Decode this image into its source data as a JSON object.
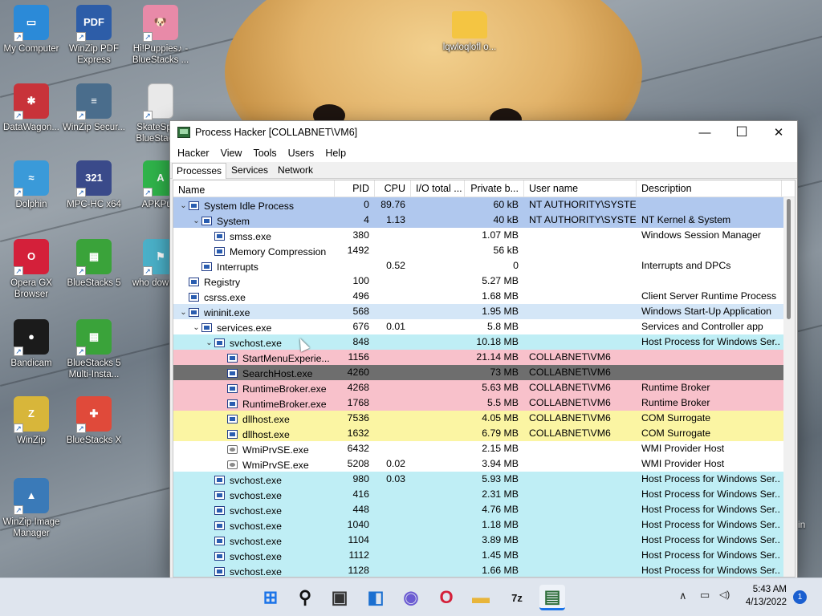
{
  "desktop": {
    "icons": [
      {
        "label": "My Computer",
        "color": "#2b8ad8",
        "glyph": "▭",
        "icon": "monitor-icon"
      },
      {
        "label": "WinZip PDF Express",
        "color": "#2d5da8",
        "glyph": "PDF",
        "icon": "pdf-icon"
      },
      {
        "label": "Hi!Puppies♪ - BlueStacks ...",
        "color": "#e88aa8",
        "glyph": "🐶",
        "icon": "puppy-game-icon"
      },
      {
        "label": "DataWagon...",
        "color": "#c8333a",
        "glyph": "✱",
        "icon": "datawagon-icon"
      },
      {
        "label": "WinZip Secur...",
        "color": "#4a6d8c",
        "glyph": "≡",
        "icon": "server-icon"
      },
      {
        "label": "SkateSpa... BlueStack...",
        "color": "#e9e9e9",
        "glyph": "",
        "icon": "document-icon"
      },
      {
        "label": "Dolphin",
        "color": "#3a9ad9",
        "glyph": "≈",
        "icon": "dolphin-icon"
      },
      {
        "label": "MPC-HC x64",
        "color": "#3a4a8a",
        "glyph": "321",
        "icon": "mpc-hc-icon"
      },
      {
        "label": "APKPu...",
        "color": "#2fb34a",
        "glyph": "A",
        "icon": "apkpure-icon"
      },
      {
        "label": "Opera GX Browser",
        "color": "#d4203a",
        "glyph": "O",
        "icon": "opera-gx-icon"
      },
      {
        "label": "BlueStacks 5",
        "color": "#3aa33a",
        "glyph": "▦",
        "icon": "bluestacks-icon"
      },
      {
        "label": "who downlo...",
        "color": "#4ab0c8",
        "glyph": "⚑",
        "icon": "walker-icon"
      },
      {
        "label": "Bandicam",
        "color": "#1b1b1b",
        "glyph": "●",
        "icon": "bandicam-icon"
      },
      {
        "label": "BlueStacks 5 Multi-Insta...",
        "color": "#3aa33a",
        "glyph": "▦",
        "icon": "bluestacks-multi-icon"
      },
      {
        "label": "WinZip",
        "color": "#d8b63a",
        "glyph": "Z",
        "icon": "winzip-icon"
      },
      {
        "label": "BlueStacks X",
        "color": "#e04a3a",
        "glyph": "✚",
        "icon": "bluestacks-x-icon"
      },
      {
        "label": "WinZip Image Manager",
        "color": "#3a7ab8",
        "glyph": "▲",
        "icon": "image-manager-icon"
      },
      {
        "label": "lqwloqlofl o...",
        "color": "#f4c542",
        "glyph": "",
        "icon": "folder-icon"
      }
    ],
    "edge_text": "in"
  },
  "window": {
    "title": "Process Hacker [COLLABNET\\VM6]",
    "controls": {
      "minimize": "—",
      "maximize": "☐",
      "close": "✕"
    },
    "menu": [
      "Hacker",
      "View",
      "Tools",
      "Users",
      "Help"
    ],
    "tabs": [
      "Processes",
      "Services",
      "Network"
    ],
    "active_tab": "Processes",
    "columns": [
      "Name",
      "PID",
      "CPU",
      "I/O total ...",
      "Private b...",
      "User name",
      "Description"
    ]
  },
  "processes": [
    {
      "name": "System Idle Process",
      "pid": "0",
      "cpu": "89.76",
      "io": "",
      "priv": "60 kB",
      "user": "NT AUTHORITY\\SYSTEM",
      "desc": "",
      "indent": 0,
      "exp": "⌄",
      "bg": "#b0c8ee",
      "fg": "#000",
      "icon": "window"
    },
    {
      "name": "System",
      "pid": "4",
      "cpu": "1.13",
      "io": "",
      "priv": "40 kB",
      "user": "NT AUTHORITY\\SYSTEM",
      "desc": "NT Kernel & System",
      "indent": 1,
      "exp": "⌄",
      "bg": "#b0c8ee",
      "fg": "#000",
      "icon": "window"
    },
    {
      "name": "smss.exe",
      "pid": "380",
      "cpu": "",
      "io": "",
      "priv": "1.07 MB",
      "user": "",
      "desc": "Windows Session Manager",
      "indent": 2,
      "exp": "",
      "bg": "#ffffff",
      "fg": "#000",
      "icon": "window"
    },
    {
      "name": "Memory Compression",
      "pid": "1492",
      "cpu": "",
      "io": "",
      "priv": "56 kB",
      "user": "",
      "desc": "",
      "indent": 2,
      "exp": "",
      "bg": "#ffffff",
      "fg": "#000",
      "icon": "window"
    },
    {
      "name": "Interrupts",
      "pid": "",
      "cpu": "0.52",
      "io": "",
      "priv": "0",
      "user": "",
      "desc": "Interrupts and DPCs",
      "indent": 1,
      "exp": "",
      "bg": "#ffffff",
      "fg": "#000",
      "icon": "window"
    },
    {
      "name": "Registry",
      "pid": "100",
      "cpu": "",
      "io": "",
      "priv": "5.27 MB",
      "user": "",
      "desc": "",
      "indent": 0,
      "exp": "",
      "bg": "#ffffff",
      "fg": "#000",
      "icon": "window"
    },
    {
      "name": "csrss.exe",
      "pid": "496",
      "cpu": "",
      "io": "",
      "priv": "1.68 MB",
      "user": "",
      "desc": "Client Server Runtime Process",
      "indent": 0,
      "exp": "",
      "bg": "#ffffff",
      "fg": "#000",
      "icon": "window"
    },
    {
      "name": "wininit.exe",
      "pid": "568",
      "cpu": "",
      "io": "",
      "priv": "1.95 MB",
      "user": "",
      "desc": "Windows Start-Up Application",
      "indent": 0,
      "exp": "⌄",
      "bg": "#d4e6f7",
      "fg": "#000",
      "icon": "window"
    },
    {
      "name": "services.exe",
      "pid": "676",
      "cpu": "0.01",
      "io": "",
      "priv": "5.8 MB",
      "user": "",
      "desc": "Services and Controller app",
      "indent": 1,
      "exp": "⌄",
      "bg": "#ffffff",
      "fg": "#000",
      "icon": "window"
    },
    {
      "name": "svchost.exe",
      "pid": "848",
      "cpu": "",
      "io": "",
      "priv": "10.18 MB",
      "user": "",
      "desc": "Host Process for Windows Ser...",
      "indent": 2,
      "exp": "⌄",
      "bg": "#bfeef5",
      "fg": "#000",
      "icon": "window"
    },
    {
      "name": "StartMenuExperie...",
      "pid": "1156",
      "cpu": "",
      "io": "",
      "priv": "21.14 MB",
      "user": "COLLABNET\\VM6",
      "desc": "",
      "indent": 3,
      "exp": "",
      "bg": "#f8c1cb",
      "fg": "#000",
      "icon": "window"
    },
    {
      "name": "SearchHost.exe",
      "pid": "4260",
      "cpu": "",
      "io": "",
      "priv": "73 MB",
      "user": "COLLABNET\\VM6",
      "desc": "",
      "indent": 3,
      "exp": "",
      "bg": "#6e6e6e",
      "fg": "#000",
      "icon": "window"
    },
    {
      "name": "RuntimeBroker.exe",
      "pid": "4268",
      "cpu": "",
      "io": "",
      "priv": "5.63 MB",
      "user": "COLLABNET\\VM6",
      "desc": "Runtime Broker",
      "indent": 3,
      "exp": "",
      "bg": "#f8c1cb",
      "fg": "#000",
      "icon": "window"
    },
    {
      "name": "RuntimeBroker.exe",
      "pid": "1768",
      "cpu": "",
      "io": "",
      "priv": "5.5 MB",
      "user": "COLLABNET\\VM6",
      "desc": "Runtime Broker",
      "indent": 3,
      "exp": "",
      "bg": "#f8c1cb",
      "fg": "#000",
      "icon": "window"
    },
    {
      "name": "dllhost.exe",
      "pid": "7536",
      "cpu": "",
      "io": "",
      "priv": "4.05 MB",
      "user": "COLLABNET\\VM6",
      "desc": "COM Surrogate",
      "indent": 3,
      "exp": "",
      "bg": "#fbf5a3",
      "fg": "#000",
      "icon": "window"
    },
    {
      "name": "dllhost.exe",
      "pid": "1632",
      "cpu": "",
      "io": "",
      "priv": "6.79 MB",
      "user": "COLLABNET\\VM6",
      "desc": "COM Surrogate",
      "indent": 3,
      "exp": "",
      "bg": "#fbf5a3",
      "fg": "#000",
      "icon": "window"
    },
    {
      "name": "WmiPrvSE.exe",
      "pid": "6432",
      "cpu": "",
      "io": "",
      "priv": "2.15 MB",
      "user": "",
      "desc": "WMI Provider Host",
      "indent": 3,
      "exp": "",
      "bg": "#ffffff",
      "fg": "#000",
      "icon": "gear"
    },
    {
      "name": "WmiPrvSE.exe",
      "pid": "5208",
      "cpu": "0.02",
      "io": "",
      "priv": "3.94 MB",
      "user": "",
      "desc": "WMI Provider Host",
      "indent": 3,
      "exp": "",
      "bg": "#ffffff",
      "fg": "#000",
      "icon": "gear"
    },
    {
      "name": "svchost.exe",
      "pid": "980",
      "cpu": "0.03",
      "io": "",
      "priv": "5.93 MB",
      "user": "",
      "desc": "Host Process for Windows Ser...",
      "indent": 2,
      "exp": "",
      "bg": "#bfeef5",
      "fg": "#000",
      "icon": "window"
    },
    {
      "name": "svchost.exe",
      "pid": "416",
      "cpu": "",
      "io": "",
      "priv": "2.31 MB",
      "user": "",
      "desc": "Host Process for Windows Ser...",
      "indent": 2,
      "exp": "",
      "bg": "#bfeef5",
      "fg": "#000",
      "icon": "window"
    },
    {
      "name": "svchost.exe",
      "pid": "448",
      "cpu": "",
      "io": "",
      "priv": "4.76 MB",
      "user": "",
      "desc": "Host Process for Windows Ser...",
      "indent": 2,
      "exp": "",
      "bg": "#bfeef5",
      "fg": "#000",
      "icon": "window"
    },
    {
      "name": "svchost.exe",
      "pid": "1040",
      "cpu": "",
      "io": "",
      "priv": "1.18 MB",
      "user": "",
      "desc": "Host Process for Windows Ser...",
      "indent": 2,
      "exp": "",
      "bg": "#bfeef5",
      "fg": "#000",
      "icon": "window"
    },
    {
      "name": "svchost.exe",
      "pid": "1104",
      "cpu": "",
      "io": "",
      "priv": "3.89 MB",
      "user": "",
      "desc": "Host Process for Windows Ser...",
      "indent": 2,
      "exp": "",
      "bg": "#bfeef5",
      "fg": "#000",
      "icon": "window"
    },
    {
      "name": "svchost.exe",
      "pid": "1112",
      "cpu": "",
      "io": "",
      "priv": "1.45 MB",
      "user": "",
      "desc": "Host Process for Windows Ser...",
      "indent": 2,
      "exp": "",
      "bg": "#bfeef5",
      "fg": "#000",
      "icon": "window"
    },
    {
      "name": "svchost.exe",
      "pid": "1128",
      "cpu": "",
      "io": "",
      "priv": "1.66 MB",
      "user": "",
      "desc": "Host Process for Windows Ser...",
      "indent": 2,
      "exp": "",
      "bg": "#bfeef5",
      "fg": "#000",
      "icon": "window"
    }
  ],
  "taskbar": {
    "items": [
      {
        "icon": "windows-start-icon",
        "glyph": "⊞",
        "color": "#1a73e8"
      },
      {
        "icon": "search-icon",
        "glyph": "⚲",
        "color": "#111"
      },
      {
        "icon": "task-view-icon",
        "glyph": "▣",
        "color": "#333"
      },
      {
        "icon": "widgets-icon",
        "glyph": "◧",
        "color": "#1a6fd0"
      },
      {
        "icon": "chat-icon",
        "glyph": "◉",
        "color": "#6b5bd2"
      },
      {
        "icon": "opera-icon",
        "glyph": "O",
        "color": "#d4203a"
      },
      {
        "icon": "file-explorer-icon",
        "glyph": "▬",
        "color": "#e8b53a"
      },
      {
        "icon": "7zip-icon",
        "glyph": "7z",
        "color": "#111"
      },
      {
        "icon": "process-hacker-icon",
        "glyph": "▤",
        "color": "#2f6f3b"
      }
    ],
    "tray": {
      "chevron": "∧",
      "network": "▭",
      "volume": "◁)"
    },
    "time": "5:43 AM",
    "date": "4/13/2022",
    "notifications": "1"
  }
}
